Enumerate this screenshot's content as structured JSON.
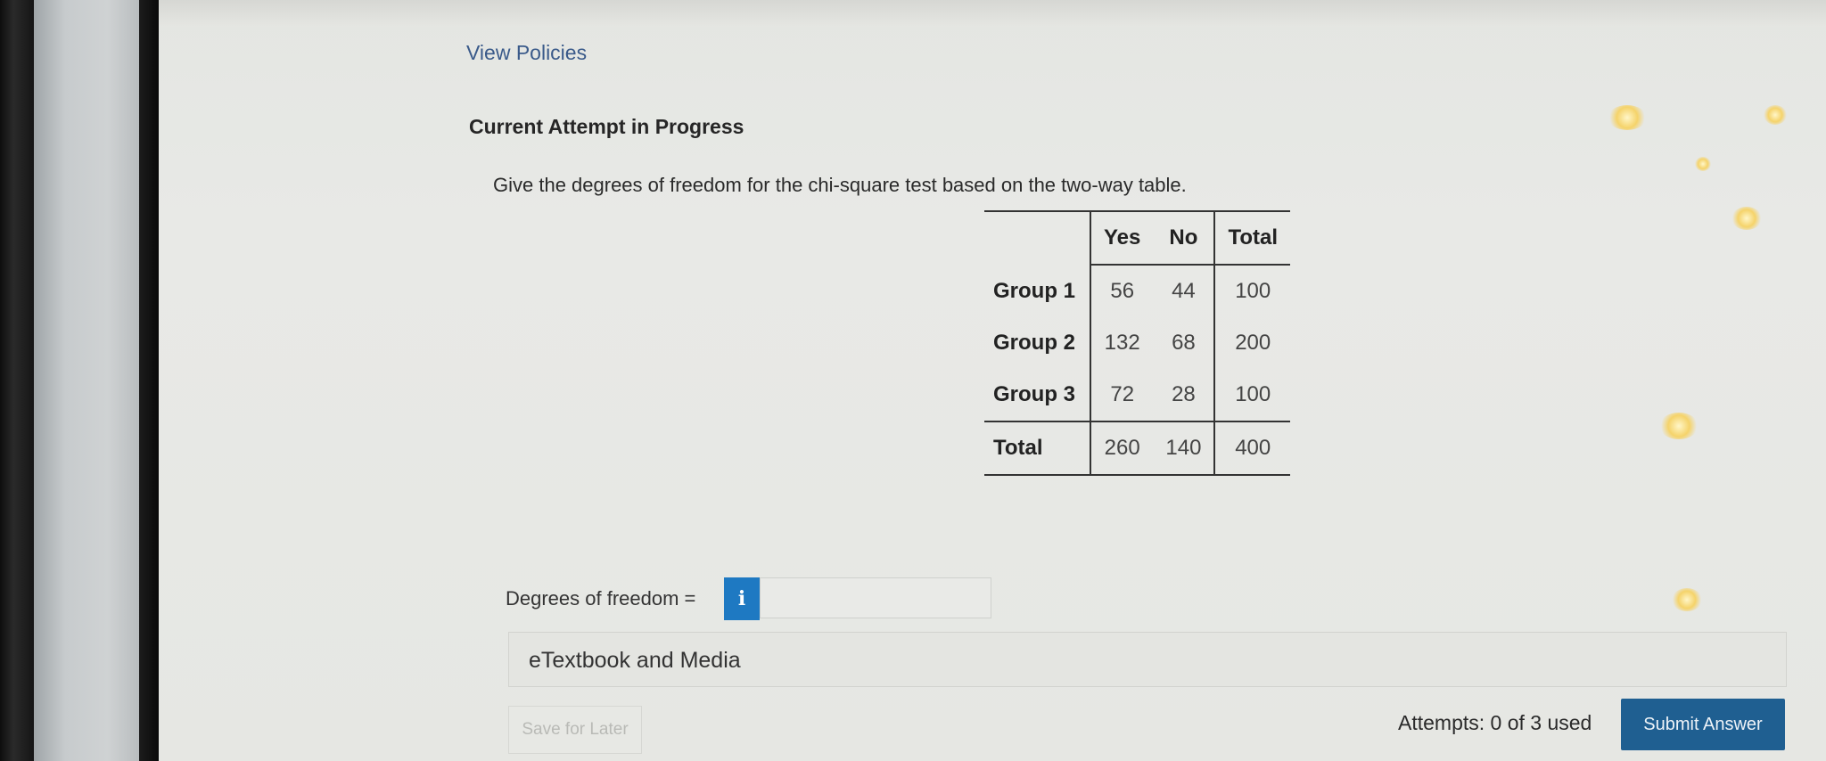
{
  "links": {
    "view_policies": "View Policies"
  },
  "heading": "Current Attempt in Progress",
  "question": "Give the degrees of freedom for the chi-square test based on the two-way table.",
  "table": {
    "columns": [
      "Yes",
      "No",
      "Total"
    ],
    "rows": [
      {
        "label": "Group 1",
        "values": [
          "56",
          "44",
          "100"
        ]
      },
      {
        "label": "Group 2",
        "values": [
          "132",
          "68",
          "200"
        ]
      },
      {
        "label": "Group 3",
        "values": [
          "72",
          "28",
          "100"
        ]
      },
      {
        "label": "Total",
        "values": [
          "260",
          "140",
          "400"
        ]
      }
    ]
  },
  "answer": {
    "label": "Degrees of freedom =",
    "info_icon": "i",
    "value": ""
  },
  "etextbook": {
    "label": "eTextbook and Media"
  },
  "footer": {
    "save_label": "Save for Later",
    "attempts": "Attempts: 0 of 3 used",
    "submit_label": "Submit Answer"
  },
  "colors": {
    "accent": "#1e79c2",
    "submit": "#1f5f91",
    "link": "#3a5a8a"
  }
}
